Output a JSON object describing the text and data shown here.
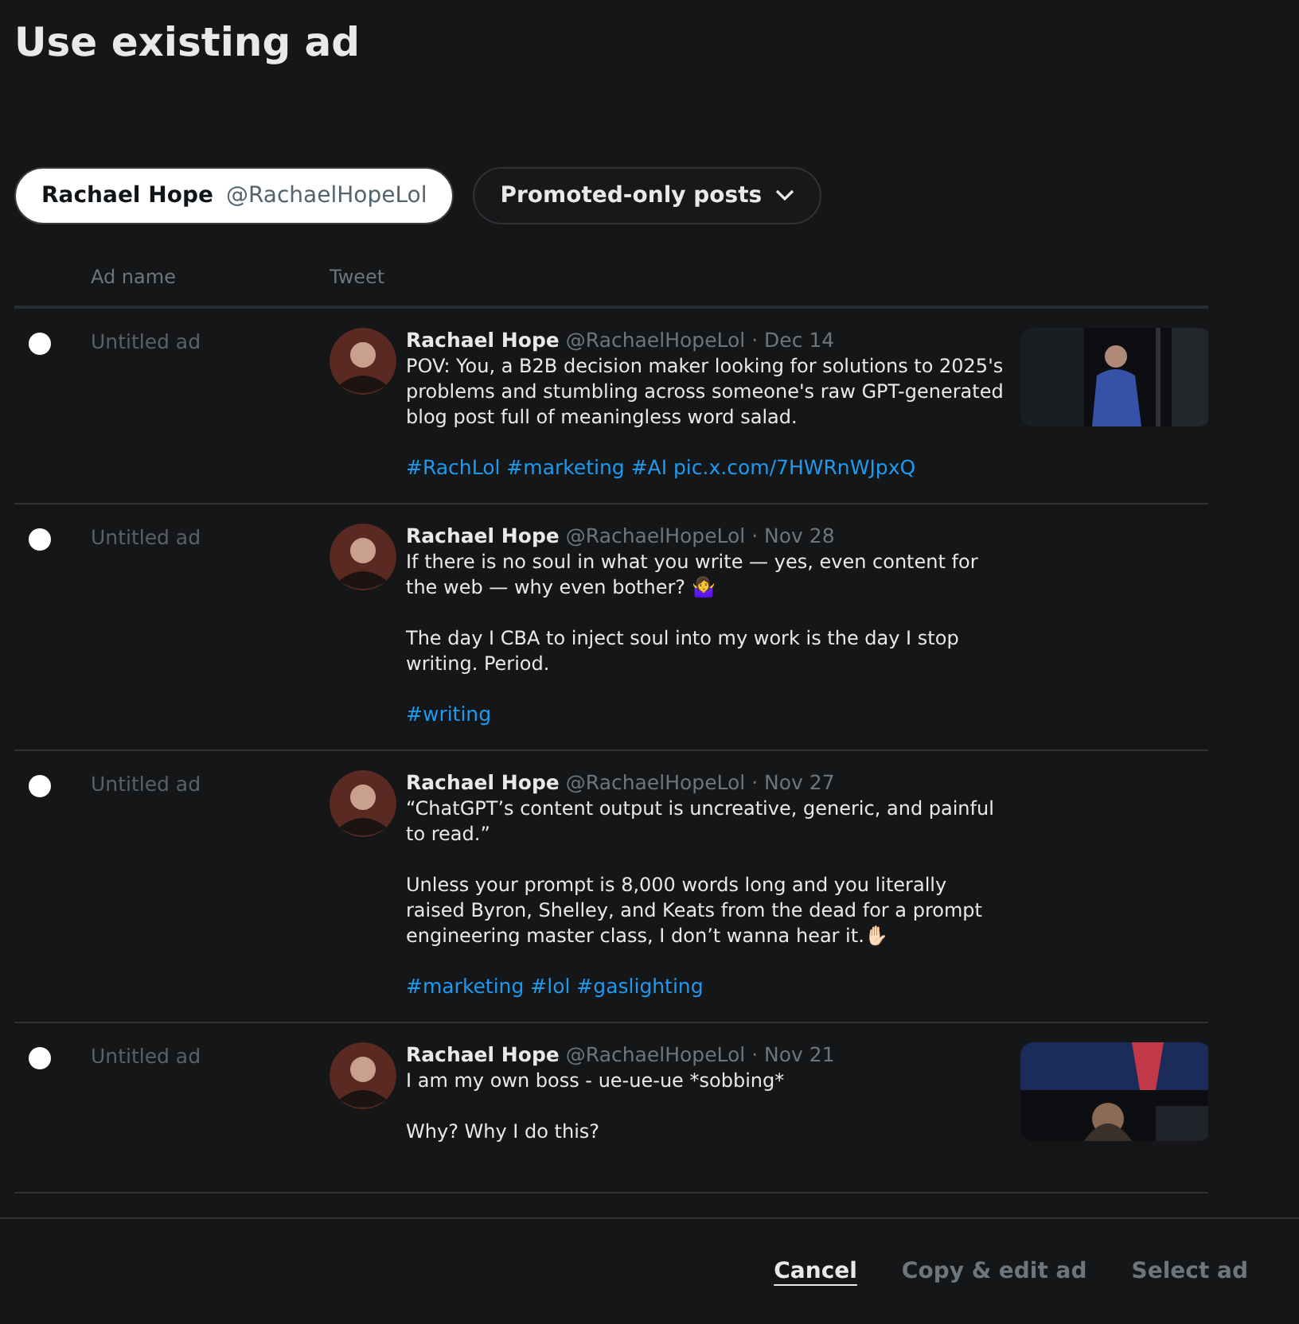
{
  "title": "Use existing ad",
  "filters": [
    {
      "kind": "account",
      "name": "Rachael Hope",
      "handle": "@RachaelHopeLol",
      "selected": true
    },
    {
      "kind": "dropdown",
      "label": "Promoted-only posts",
      "selected": false
    }
  ],
  "table": {
    "columns": [
      "Ad name",
      "Tweet"
    ],
    "rows": [
      {
        "selected": false,
        "ad_name": "Untitled ad",
        "author": "Rachael Hope",
        "meta": "@RachaelHopeLol · Dec 14",
        "paragraphs": [
          "POV: You, a B2B decision maker looking for solutions to 2025's problems and stumbling across someone's raw GPT-generated blog post full of meaningless word salad."
        ],
        "tags": "#RachLol #marketing #AI pic.x.com/7HWRnWJpxQ",
        "media": {
          "kind": "picture"
        }
      },
      {
        "selected": false,
        "ad_name": "Untitled ad",
        "author": "Rachael Hope",
        "meta": "@RachaelHopeLol · Nov 28",
        "paragraphs": [
          "If there is no soul in what you write — yes, even content for the web — why even bother? 🤷‍♀️",
          "The day I CBA to inject soul into my work is the day I stop writing. Period."
        ],
        "tags": "#writing"
      },
      {
        "selected": false,
        "ad_name": "Untitled ad",
        "author": "Rachael Hope",
        "meta": "@RachaelHopeLol · Nov 27",
        "paragraphs": [
          "“ChatGPT’s content output is uncreative, generic, and painful to read.”",
          "Unless your prompt is 8,000 words long and you literally raised Byron, Shelley, and Keats from the dead for a prompt engineering master class, I don’t wanna hear it.✋🏻"
        ],
        "tags": "#marketing #lol #gaslighting"
      },
      {
        "selected": false,
        "ad_name": "Untitled ad",
        "author": "Rachael Hope",
        "meta": "@RachaelHopeLol · Nov 21",
        "paragraphs": [
          "I am my own boss - ue-ue-ue *sobbing*",
          "Why? Why I do this?"
        ],
        "media": {
          "kind": "picture"
        }
      }
    ]
  },
  "footer": [
    {
      "label": "Cancel",
      "disabled": false
    },
    {
      "label": "Copy & edit ad",
      "disabled": true
    },
    {
      "label": "Select ad",
      "disabled": true
    }
  ]
}
